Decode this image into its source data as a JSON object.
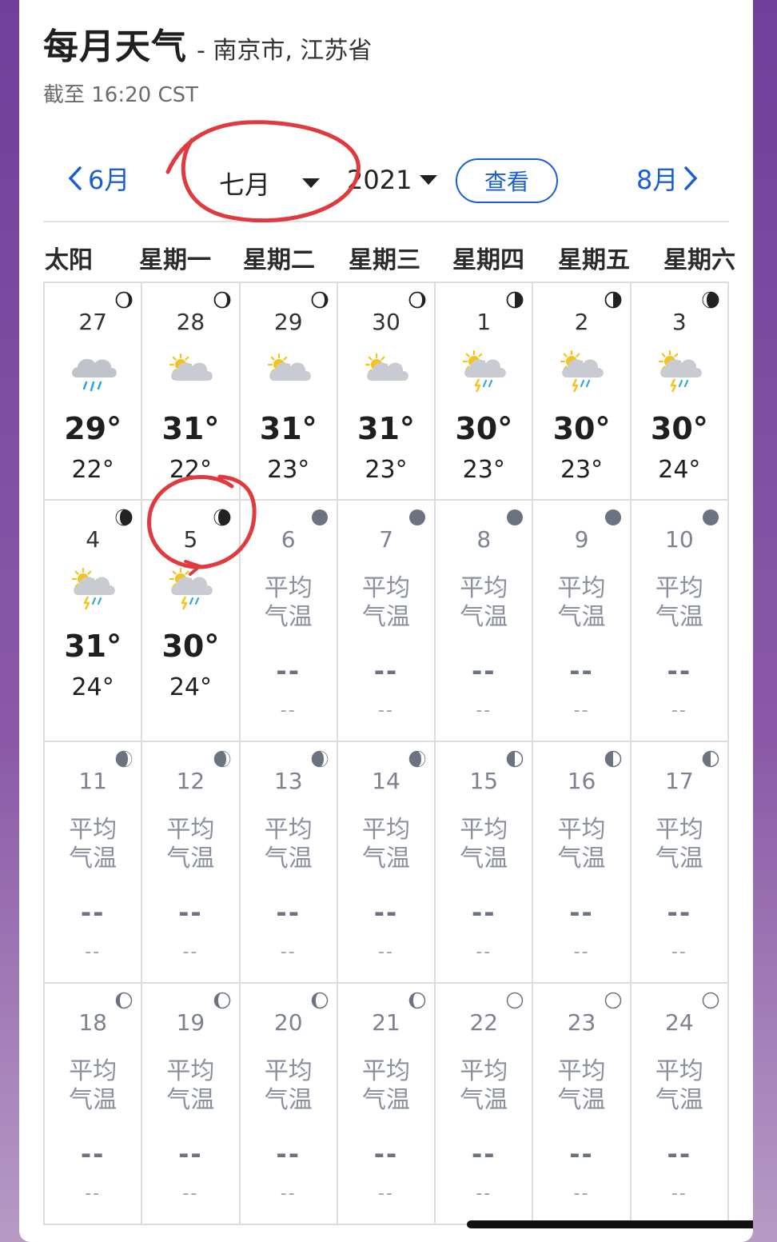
{
  "header": {
    "title": "每月天气",
    "location": "- 南京市, 江苏省",
    "as_of": "截至 16:20 CST"
  },
  "nav": {
    "prev_month": "6月",
    "month_selected": "七月",
    "year_selected": "2021",
    "view_button": "查看",
    "next_month": "8月"
  },
  "weekdays": [
    "太阳",
    "星期一",
    "星期二",
    "星期三",
    "星期四",
    "星期五",
    "星期六"
  ],
  "future_labels": {
    "avg_line1": "平均",
    "avg_line2": "气温",
    "hi_placeholder": "--",
    "lo_placeholder": "--"
  },
  "weeks": [
    [
      {
        "day": "27",
        "hi": "29°",
        "lo": "22°",
        "icon": "rain-cloud-icon",
        "moon": "waxing-crescent-icon"
      },
      {
        "day": "28",
        "hi": "31°",
        "lo": "22°",
        "icon": "partly-sunny-icon",
        "moon": "waxing-crescent-icon"
      },
      {
        "day": "29",
        "hi": "31°",
        "lo": "23°",
        "icon": "partly-sunny-icon",
        "moon": "waxing-crescent-icon"
      },
      {
        "day": "30",
        "hi": "31°",
        "lo": "23°",
        "icon": "partly-sunny-icon",
        "moon": "waxing-crescent-icon"
      },
      {
        "day": "1",
        "hi": "30°",
        "lo": "23°",
        "icon": "sun-thunderstorm-icon",
        "moon": "first-quarter-icon"
      },
      {
        "day": "2",
        "hi": "30°",
        "lo": "23°",
        "icon": "sun-thunderstorm-icon",
        "moon": "first-quarter-icon"
      },
      {
        "day": "3",
        "hi": "30°",
        "lo": "24°",
        "icon": "sun-thunderstorm-icon",
        "moon": "waxing-gibbous-icon"
      }
    ],
    [
      {
        "day": "4",
        "hi": "31°",
        "lo": "24°",
        "icon": "sun-thunderstorm-icon",
        "moon": "waxing-gibbous-icon"
      },
      {
        "day": "5",
        "hi": "30°",
        "lo": "24°",
        "icon": "sun-thunderstorm-icon",
        "moon": "waxing-gibbous-icon"
      },
      {
        "day": "6",
        "future": true,
        "moon": "full-moon-icon"
      },
      {
        "day": "7",
        "future": true,
        "moon": "full-moon-icon"
      },
      {
        "day": "8",
        "future": true,
        "moon": "full-moon-icon"
      },
      {
        "day": "9",
        "future": true,
        "moon": "full-moon-icon"
      },
      {
        "day": "10",
        "future": true,
        "moon": "full-moon-icon"
      }
    ],
    [
      {
        "day": "11",
        "future": true,
        "moon": "waning-gibbous-icon"
      },
      {
        "day": "12",
        "future": true,
        "moon": "waning-gibbous-icon"
      },
      {
        "day": "13",
        "future": true,
        "moon": "waning-gibbous-icon"
      },
      {
        "day": "14",
        "future": true,
        "moon": "waning-gibbous-icon"
      },
      {
        "day": "15",
        "future": true,
        "moon": "last-quarter-icon"
      },
      {
        "day": "16",
        "future": true,
        "moon": "last-quarter-icon"
      },
      {
        "day": "17",
        "future": true,
        "moon": "last-quarter-icon"
      }
    ],
    [
      {
        "day": "18",
        "future": true,
        "moon": "waning-crescent-icon"
      },
      {
        "day": "19",
        "future": true,
        "moon": "waning-crescent-icon"
      },
      {
        "day": "20",
        "future": true,
        "moon": "waning-crescent-icon"
      },
      {
        "day": "21",
        "future": true,
        "moon": "waning-crescent-icon"
      },
      {
        "day": "22",
        "future": true,
        "moon": "new-moon-icon"
      },
      {
        "day": "23",
        "future": true,
        "moon": "new-moon-icon"
      },
      {
        "day": "24",
        "future": true,
        "moon": "new-moon-icon"
      }
    ]
  ],
  "colors": {
    "link": "#1a5fd0",
    "annotation": "#e0393e",
    "future_text": "#8a909c",
    "moon_future": "#6b7280"
  }
}
